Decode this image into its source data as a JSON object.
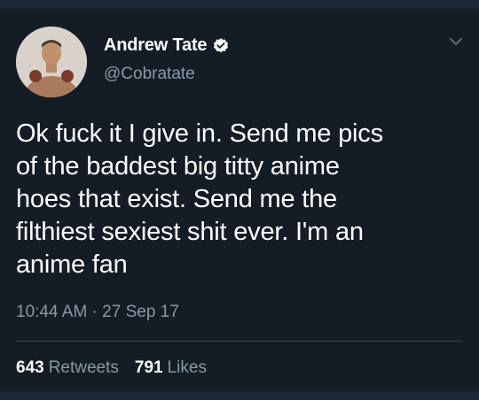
{
  "tweet": {
    "author_name": "Andrew Tate",
    "handle": "@Cobratate",
    "text": "Ok fuck it I give in. Send me pics\nof the baddest big titty anime\nhoes that exist. Send me the\nfilthiest sexiest shit ever. I'm an\nanime fan",
    "timestamp": "10:44 AM · 27 Sep 17",
    "retweets_count": "643",
    "retweets_label": "Retweets",
    "likes_count": "791",
    "likes_label": "Likes"
  },
  "icons": {
    "verified": "verified-badge-icon",
    "menu": "chevron-down-icon"
  },
  "colors": {
    "background": "#141d26",
    "secondary_text": "#8899a6",
    "divider": "#38444d"
  }
}
